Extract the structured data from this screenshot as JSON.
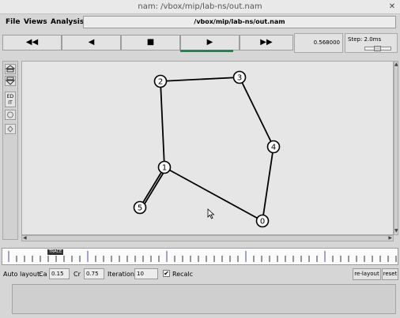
{
  "window": {
    "title": "nam: /vbox/mip/lab-ns/out.nam",
    "close_label": "✕"
  },
  "menu": {
    "file": "File",
    "views": "Views",
    "analysis": "Analysis"
  },
  "file_path": "/vbox/mip/lab-ns/out.nam",
  "transport": {
    "rewind_icon": "fast-rewind-icon",
    "back_icon": "play-backward-icon",
    "stop_icon": "stop-icon",
    "play_icon": "play-icon",
    "forward_icon": "fast-forward-icon",
    "rewind_glyph": "◀◀",
    "back_glyph": "◀",
    "stop_glyph": "■",
    "play_glyph": "▶",
    "forward_glyph": "▶▶",
    "active": "play"
  },
  "time": "0.568000",
  "step": {
    "label": "Step: 2.0ms",
    "level": 0.5
  },
  "left_toolbar": {
    "zoom_in_icon": "zoom-in-icon",
    "zoom_out_icon": "zoom-out-icon",
    "edit_label": "ED\nIT"
  },
  "network": {
    "nodes": [
      {
        "id": "0"
      },
      {
        "id": "1"
      },
      {
        "id": "2"
      },
      {
        "id": "3"
      },
      {
        "id": "4"
      },
      {
        "id": "5"
      }
    ],
    "links": [
      [
        "2",
        "3"
      ],
      [
        "3",
        "4"
      ],
      [
        "4",
        "0"
      ],
      [
        "0",
        "1"
      ],
      [
        "1",
        "2"
      ],
      [
        "1",
        "5"
      ]
    ],
    "node_colors": {
      "fill": "#ffffff",
      "stroke": "#000000"
    }
  },
  "timeline": {
    "marker": "TRACE",
    "position": 0.13
  },
  "auto_layout": {
    "label": "Auto layout:",
    "ca_label": "Ca",
    "ca_value": "0.15",
    "cr_label": "Cr",
    "cr_value": "0.75",
    "iterations_label": "Iterations",
    "iterations_value": "10",
    "recalc_label": "Recalc",
    "recalc_checked": "✔",
    "relayout_label": "re-layout",
    "reset_label": "reset"
  },
  "colors": {
    "background": "#d6d6d6",
    "canvas": "#e6e6e6",
    "play_indicator": "#2f7d55"
  }
}
